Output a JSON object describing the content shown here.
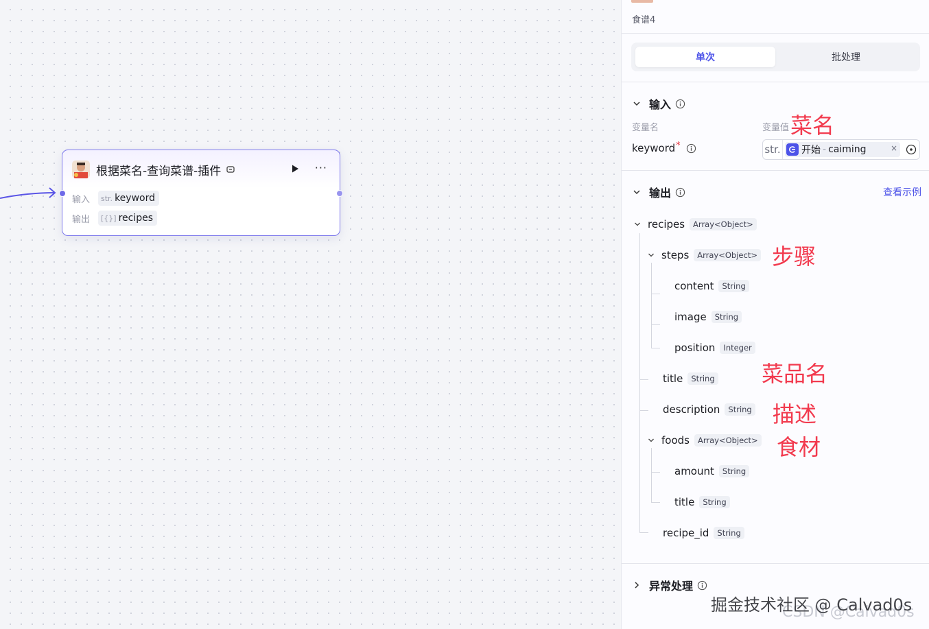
{
  "node": {
    "title": "根据菜名-查询菜谱-插件",
    "input_label": "输入",
    "input_type": "str.",
    "input_name": "keyword",
    "output_label": "输出",
    "output_type": "[{}]",
    "output_name": "recipes"
  },
  "panel": {
    "recipe_name": "食谱4",
    "tabs": [
      "单次",
      "批处理"
    ],
    "input_section": {
      "title": "输入",
      "col_var_name": "变量名",
      "col_var_value": "变量值",
      "param_name": "keyword",
      "required_mark": "*",
      "value_type": "str.",
      "ref_node": "开始",
      "ref_sep": "-",
      "ref_var": "caiming",
      "clear": "×"
    },
    "output_section": {
      "title": "输出",
      "view_example": "查看示例",
      "tree": [
        {
          "name": "recipes",
          "type": "Array<Object>"
        },
        {
          "name": "steps",
          "type": "Array<Object>"
        },
        {
          "name": "content",
          "type": "String"
        },
        {
          "name": "image",
          "type": "String"
        },
        {
          "name": "position",
          "type": "Integer"
        },
        {
          "name": "title",
          "type": "String"
        },
        {
          "name": "description",
          "type": "String"
        },
        {
          "name": "foods",
          "type": "Array<Object>"
        },
        {
          "name": "amount",
          "type": "String"
        },
        {
          "name": "title",
          "type": "String"
        },
        {
          "name": "recipe_id",
          "type": "String"
        }
      ]
    },
    "exception_section": {
      "title": "异常处理"
    }
  },
  "annotations": {
    "dish_name": "菜名",
    "steps": "步骤",
    "dish_title": "菜品名",
    "description": "描述",
    "ingredients": "食材"
  },
  "watermark": {
    "primary": "掘金技术社区 @ Calvad0s",
    "secondary": "CSDN @Calvad0s"
  },
  "colors": {
    "accent": "#4d53e8",
    "annotation": "#f23a4e",
    "node_border": "#7d79ec"
  }
}
